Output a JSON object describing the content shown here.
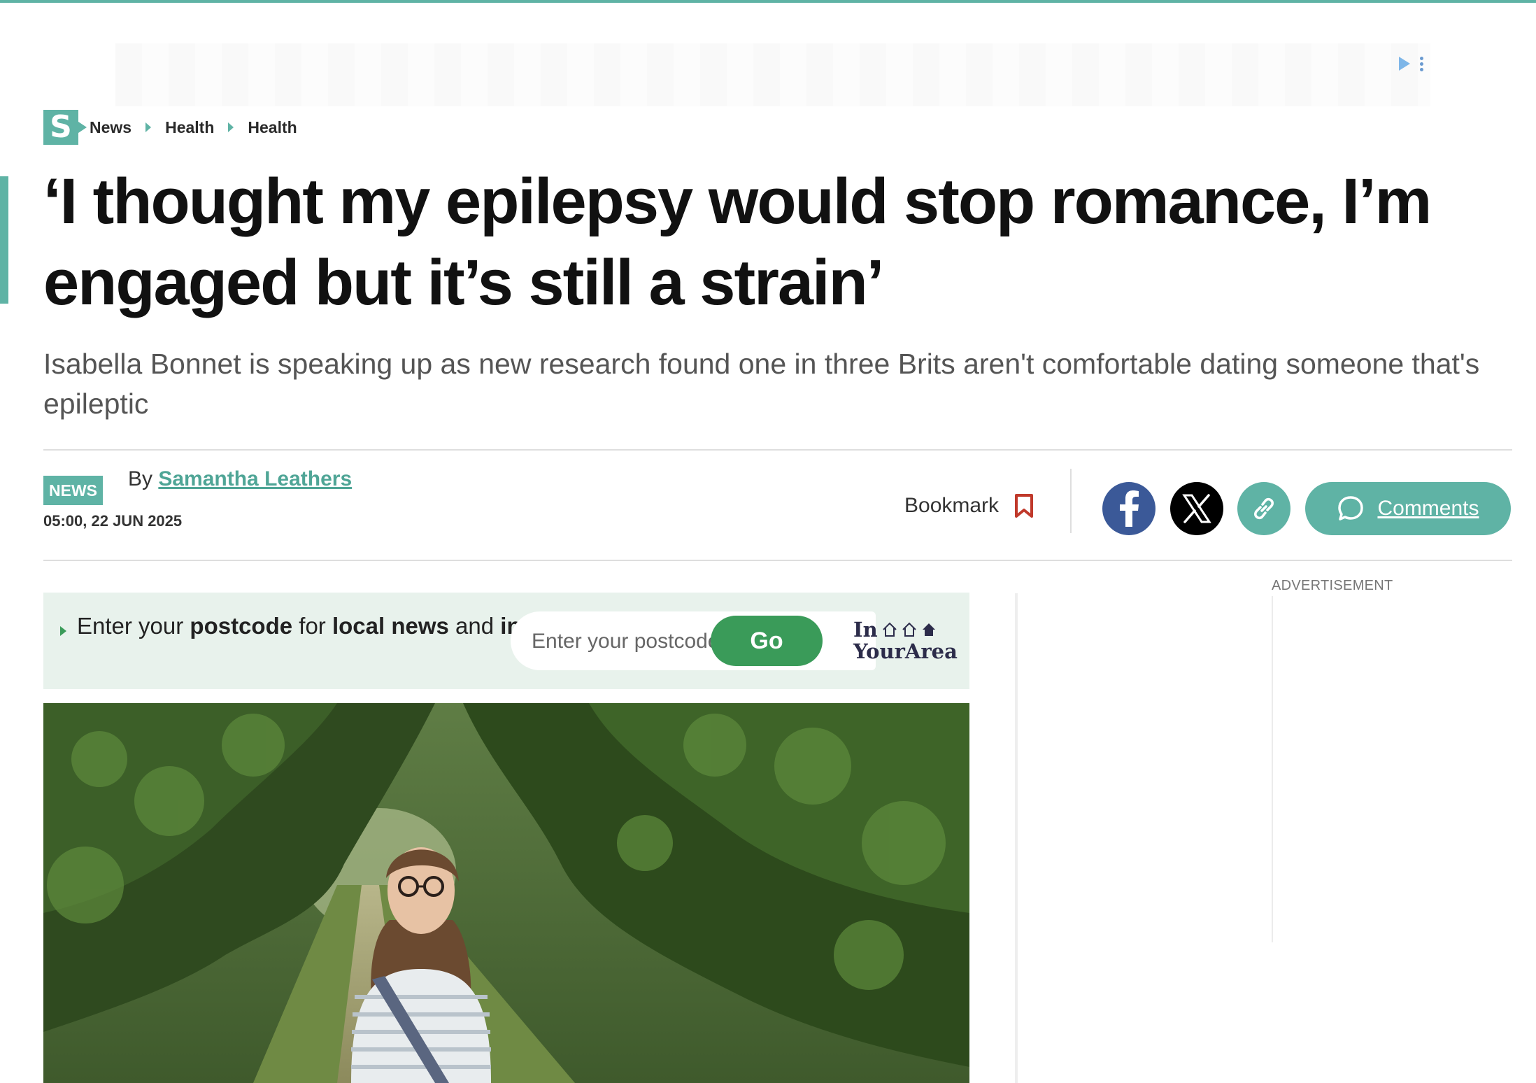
{
  "breadcrumb": {
    "logo": "S",
    "items": [
      "News",
      "Health",
      "Health"
    ]
  },
  "article": {
    "headline": "‘I thought my epilepsy would stop romance, I’m engaged but it’s still a strain’",
    "standfirst": "Isabella Bonnet is speaking up as new research found one in three Brits aren't comfortable dating someone that's epileptic",
    "tag": "NEWS",
    "by_prefix": "By",
    "author": "Samantha Leathers",
    "timestamp": "05:00, 22 JUN 2025"
  },
  "actions": {
    "bookmark_label": "Bookmark",
    "comments_label": "Comments"
  },
  "postcode": {
    "text_1": "Enter your ",
    "text_bold_1": "postcode",
    "text_2": " for ",
    "text_bold_2": "local news",
    "text_3": " and ",
    "text_bold_3": "info",
    "placeholder": "Enter your postcode",
    "go_label": "Go",
    "brand_line1": "In",
    "brand_line2": "YourArea"
  },
  "sidebar": {
    "ad_label": "ADVERTISEMENT"
  },
  "colors": {
    "accent": "#5fb3a5",
    "facebook": "#3b5998",
    "go_button": "#3a9b59",
    "bookmark": "#c0392b"
  }
}
